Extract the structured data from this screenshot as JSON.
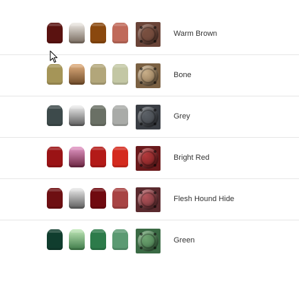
{
  "rows": [
    {
      "label": "Warm Brown",
      "pots": [
        "#5a1210",
        "linear-gradient(#efece7,#76685c)",
        "#8a480e",
        "#c06a5a"
      ],
      "swatch": {
        "bg": "#6a4438",
        "pad": "#7a5040"
      }
    },
    {
      "label": "Bone",
      "pots": [
        "#a59558",
        "linear-gradient(#e2b080,#6e4a28)",
        "#b2a67a",
        "#c3c7a4"
      ],
      "swatch": {
        "bg": "#7b6143",
        "pad": "#c8ae88"
      }
    },
    {
      "label": "Grey",
      "pots": [
        "#3d4a4b",
        "linear-gradient(#f1f1f1,#5a5a5a)",
        "#6a7065",
        "#a9aba8"
      ],
      "swatch": {
        "bg": "#3a3e44",
        "pad": "#5b6066"
      }
    },
    {
      "label": "Bright Red",
      "pots": [
        "#9a1315",
        "linear-gradient(#e59ac8,#6a2440)",
        "#b31a18",
        "#d42a1e"
      ],
      "swatch": {
        "bg": "#6a1a1c",
        "pad": "#b2383a"
      }
    },
    {
      "label": "Flesh Hound Hide",
      "pots": [
        "#6e0f12",
        "linear-gradient(#ececec,#5c5c5c)",
        "#700a10",
        "#a84444"
      ],
      "swatch": {
        "bg": "#5a2a2e",
        "pad": "#b4545a"
      }
    },
    {
      "label": "Green",
      "pots": [
        "#103d2e",
        "linear-gradient(#c0e8b8,#3e7a48)",
        "#2d7b4a",
        "#5b9a72"
      ],
      "swatch": {
        "bg": "#3a6a44",
        "pad": "#6ea470"
      }
    }
  ]
}
